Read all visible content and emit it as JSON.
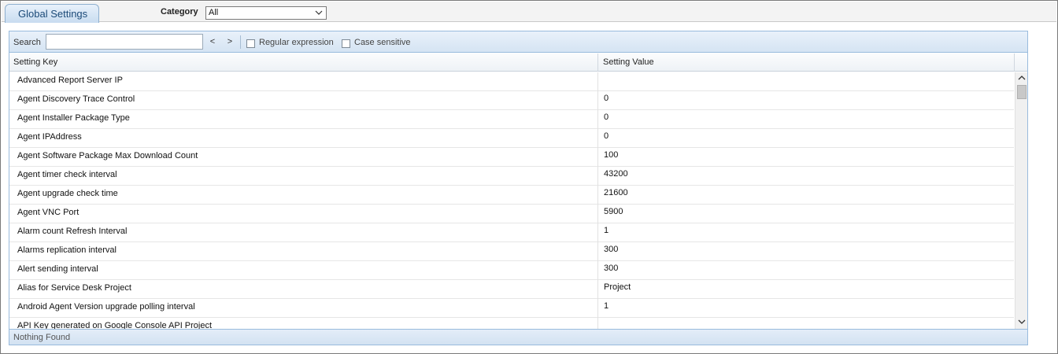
{
  "tab": {
    "label": "Global Settings"
  },
  "category": {
    "label": "Category",
    "value": "All"
  },
  "toolbar": {
    "search_label": "Search",
    "search_value": "",
    "prev_label": "<",
    "next_label": ">",
    "regex_label": "Regular expression",
    "case_label": "Case sensitive"
  },
  "table": {
    "columns": [
      "Setting Key",
      "Setting Value"
    ],
    "rows": [
      {
        "key": "Advanced Report Server IP",
        "value": ""
      },
      {
        "key": "Agent Discovery Trace Control",
        "value": "0"
      },
      {
        "key": "Agent Installer Package Type",
        "value": "0"
      },
      {
        "key": "Agent IPAddress",
        "value": "0"
      },
      {
        "key": "Agent Software Package Max Download Count",
        "value": "100"
      },
      {
        "key": "Agent timer check interval",
        "value": "43200"
      },
      {
        "key": "Agent upgrade check time",
        "value": "21600"
      },
      {
        "key": "Agent VNC Port",
        "value": "5900"
      },
      {
        "key": "Alarm count Refresh Interval",
        "value": "1"
      },
      {
        "key": "Alarms replication interval",
        "value": "300"
      },
      {
        "key": "Alert sending interval",
        "value": "300"
      },
      {
        "key": "Alias for Service Desk Project",
        "value": "Project"
      },
      {
        "key": "Android Agent Version upgrade polling interval",
        "value": "1"
      },
      {
        "key": "API Key generated on Google Console API Project",
        "value": ""
      }
    ]
  },
  "footer": {
    "status": "Nothing Found"
  },
  "icons": {
    "dropdown": "chevron-down-icon",
    "scroll_up": "chevron-up-icon",
    "scroll_down": "chevron-down-icon"
  }
}
